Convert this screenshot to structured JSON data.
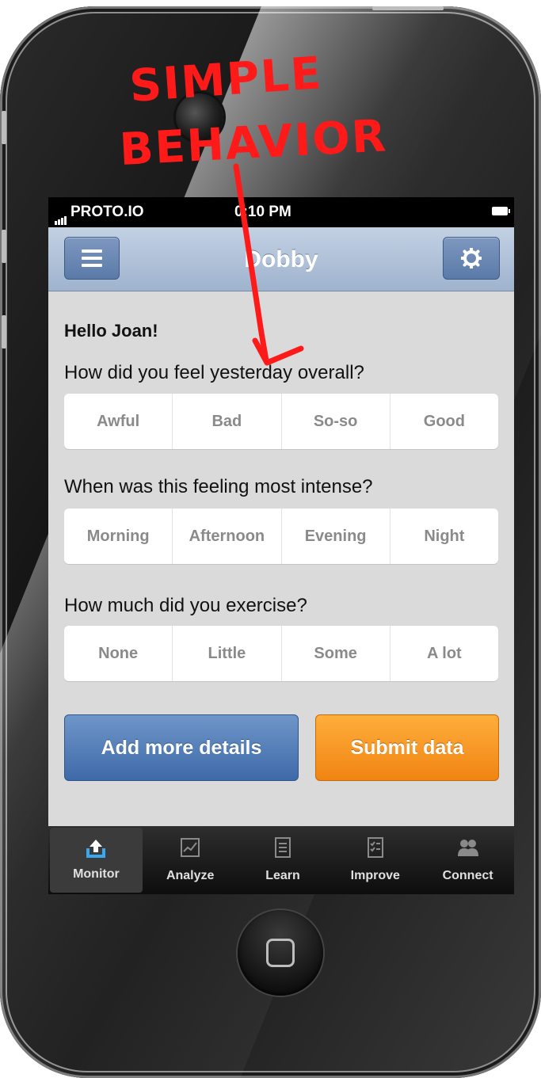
{
  "annotation": {
    "line1": "SIMPLE",
    "line2": "BEHAVIOR"
  },
  "status_bar": {
    "carrier": "PROTO.IO",
    "time": "0:10 PM"
  },
  "nav": {
    "title": "Dobby",
    "menu_icon": "menu-icon",
    "settings_icon": "gear-icon"
  },
  "content": {
    "greeting": "Hello Joan!",
    "q1": {
      "text": "How did you feel yesterday overall?",
      "options": [
        "Awful",
        "Bad",
        "So-so",
        "Good"
      ]
    },
    "q2": {
      "text": "When was this feeling most intense?",
      "options": [
        "Morning",
        "Afternoon",
        "Evening",
        "Night"
      ]
    },
    "q3": {
      "text": "How much did you exercise?",
      "options": [
        "None",
        "Little",
        "Some",
        "A lot"
      ]
    }
  },
  "buttons": {
    "details": "Add more details",
    "submit": "Submit data"
  },
  "tabs": [
    {
      "label": "Monitor",
      "icon": "upload-icon"
    },
    {
      "label": "Analyze",
      "icon": "chart-icon"
    },
    {
      "label": "Learn",
      "icon": "document-icon"
    },
    {
      "label": "Improve",
      "icon": "checklist-icon"
    },
    {
      "label": "Connect",
      "icon": "people-icon"
    }
  ],
  "colors": {
    "nav_accent": "#9fb3ce",
    "blue_button": "#3e6aa8",
    "orange_button": "#f08412",
    "annotation": "#ff1a1a"
  }
}
